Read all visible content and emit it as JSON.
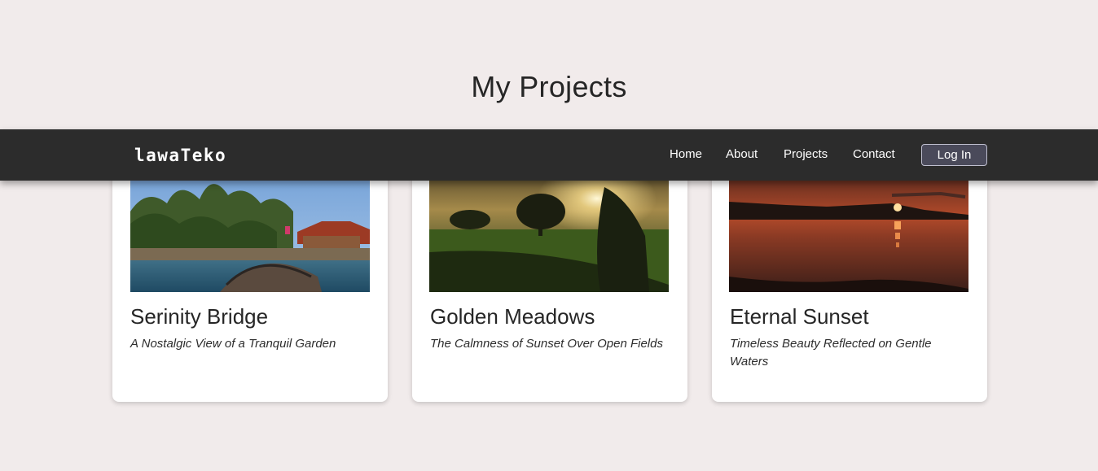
{
  "page": {
    "title": "My Projects"
  },
  "navbar": {
    "brand": "lawaTeko",
    "links": [
      {
        "label": "Home"
      },
      {
        "label": "About"
      },
      {
        "label": "Projects"
      },
      {
        "label": "Contact"
      }
    ],
    "login_label": "Log In"
  },
  "projects": [
    {
      "title": "Serinity Bridge",
      "subtitle": "A Nostalgic View of a Tranquil Garden",
      "image": "garden-bridge-photo"
    },
    {
      "title": "Golden Meadows",
      "subtitle": "The Calmness of Sunset Over Open Fields",
      "image": "meadow-sunset-photo"
    },
    {
      "title": "Eternal Sunset",
      "subtitle": "Timeless Beauty Reflected on Gentle Waters",
      "image": "water-sunset-photo"
    }
  ],
  "colors": {
    "background": "#f1ebeb",
    "navbar": "#2c2c2c",
    "card": "#ffffff",
    "login_button": "#4a4a5a"
  }
}
